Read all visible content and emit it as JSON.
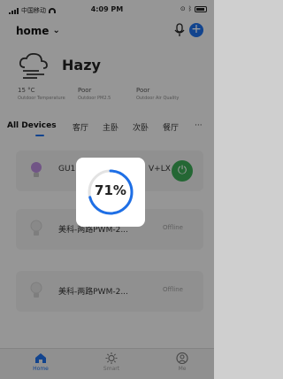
{
  "status": {
    "carrier": "中国移动",
    "time": "4:09 PM"
  },
  "header": {
    "home_label": "home"
  },
  "weather": {
    "condition": "Hazy",
    "stats": [
      {
        "value": "15 °C",
        "label": "Outdoor Temperature"
      },
      {
        "value": "Poor",
        "label": "Outdoor PM2.5"
      },
      {
        "value": "Poor",
        "label": "Outdoor Air Quality"
      }
    ]
  },
  "tabs": {
    "items": [
      "All Devices",
      "客厅",
      "主卧",
      "次卧",
      "餐厅"
    ],
    "more": "···"
  },
  "devices": [
    {
      "name": "GU1",
      "name_tail": "V+LX",
      "state": "on"
    },
    {
      "name": "美科-两路PWM-2...",
      "state_text": "Offline"
    },
    {
      "name": "美科-两路PWM-2...",
      "state_text": "Offline"
    }
  ],
  "loading": {
    "percent_text": "71%",
    "progress": 0.71
  },
  "tabbar": {
    "items": [
      "Home",
      "Smart",
      "Me"
    ]
  },
  "colors": {
    "accent": "#1e6fe6",
    "power_on": "#3aa655"
  }
}
